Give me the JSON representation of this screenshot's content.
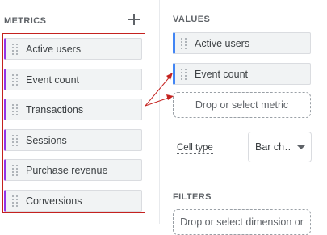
{
  "metrics_panel": {
    "header": "METRICS",
    "add_icon": "plus-icon",
    "items": [
      {
        "label": "Active users"
      },
      {
        "label": "Event count"
      },
      {
        "label": "Transactions"
      },
      {
        "label": "Sessions"
      },
      {
        "label": "Purchase revenue"
      },
      {
        "label": "Conversions"
      }
    ]
  },
  "values_panel": {
    "header": "VALUES",
    "items": [
      {
        "label": "Active users"
      },
      {
        "label": "Event count"
      }
    ],
    "drop_placeholder": "Drop or select metric",
    "cell_type_label": "Cell type",
    "cell_type_value": "Bar ch…"
  },
  "filters_panel": {
    "header": "FILTERS",
    "drop_placeholder": "Drop or select dimension or"
  },
  "colors": {
    "metric_accent": "#9334e6",
    "value_accent": "#4285f4",
    "annotation_red": "#c5221f"
  }
}
